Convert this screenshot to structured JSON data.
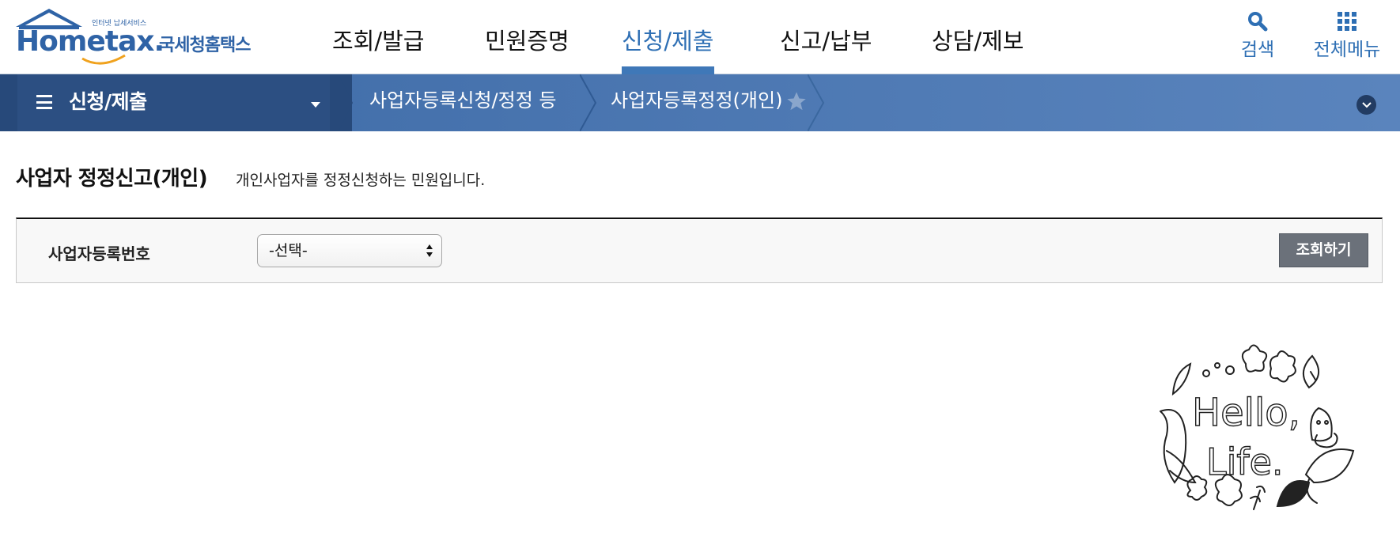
{
  "logo": {
    "wordmark": "Hometax.",
    "tagline": "인터넷 납세서비스",
    "name_ko": "국세청홈택스"
  },
  "gnb": [
    {
      "label": "조회/발급",
      "active": false
    },
    {
      "label": "민원증명",
      "active": false
    },
    {
      "label": "신청/제출",
      "active": true
    },
    {
      "label": "신고/납부",
      "active": false
    },
    {
      "label": "상담/제보",
      "active": false
    }
  ],
  "utility": {
    "search_label": "검색",
    "search_icon": "search-icon",
    "allmenu_label": "전체메뉴",
    "allmenu_icon": "grid-icon"
  },
  "location": {
    "menu_title": "신청/제출",
    "crumbs": [
      "사업자등록신청/정정 등",
      "사업자등록정정(개인)"
    ]
  },
  "page": {
    "title": "사업자 정정신고(개인)",
    "description": "개인사업자를 정정신청하는 민원입니다."
  },
  "search": {
    "label": "사업자등록번호",
    "select_value": "-선택-",
    "button_label": "조회하기"
  },
  "decoration": {
    "doodle_text": "Hello, Life."
  },
  "colors": {
    "brand_blue": "#2e6fb4",
    "locbar_dark": "#27497a",
    "locbar_light": "#5a84bd",
    "button_gray": "#6b717a"
  }
}
